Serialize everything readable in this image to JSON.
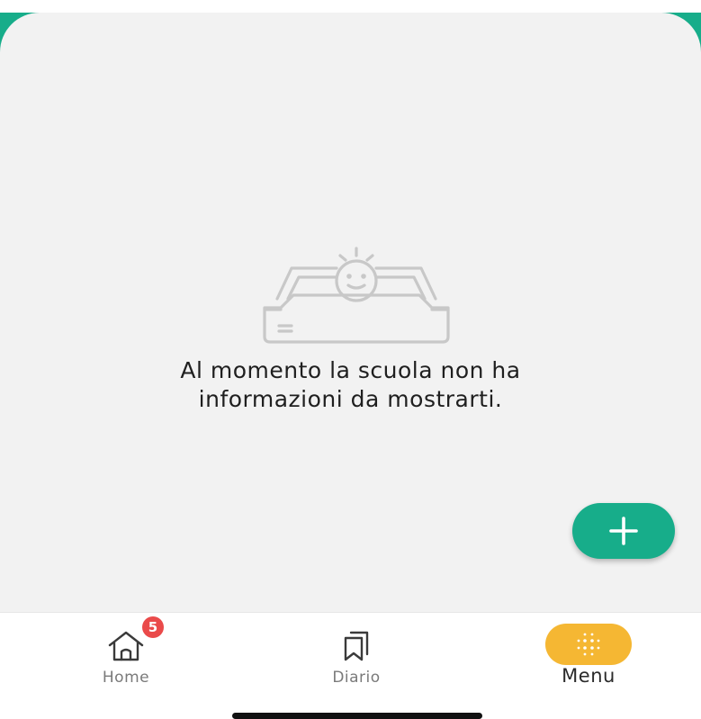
{
  "empty_state": {
    "line1": "Al momento la scuola non ha",
    "line2": "informazioni da mostrarti."
  },
  "fab": {
    "icon": "plus-icon"
  },
  "bottom_nav": {
    "items": [
      {
        "label": "Home",
        "icon": "home-icon",
        "badge": "5"
      },
      {
        "label": "Diario",
        "icon": "bookmarks-icon"
      },
      {
        "label": "Menu",
        "icon": "dots-grid-icon",
        "active": true
      }
    ]
  },
  "colors": {
    "accent": "#17ad8a",
    "badge": "#ea4a4a",
    "menu_active": "#f5b733",
    "background": "#f2f2f2"
  }
}
